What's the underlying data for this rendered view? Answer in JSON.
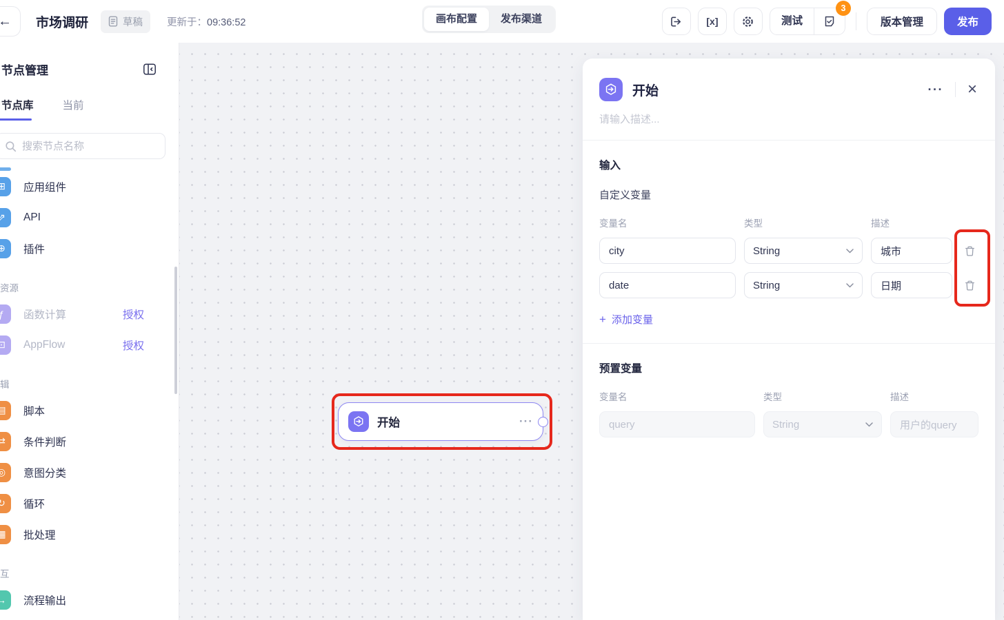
{
  "colors": {
    "accent": "#5a5fe8",
    "node_icon_purple": "#7b74f2",
    "annotation_red": "#e6281c",
    "badge_orange": "#ff9213",
    "sidebar_icon_blue": "#57a1e8",
    "sidebar_icon_lavender": "#b4aaf2",
    "sidebar_icon_orange": "#ef8f44",
    "sidebar_icon_teal": "#52c7ae"
  },
  "header": {
    "title": "市场调研",
    "draft_badge": "草稿",
    "updated_label": "更新于：",
    "updated_time": "09:36:52",
    "tabs": [
      {
        "label": "画布配置",
        "active": true
      },
      {
        "label": "发布渠道",
        "active": false
      }
    ],
    "variables_icon_text": "[x]",
    "test_label": "测试",
    "test_badge": "3",
    "version_label": "版本管理",
    "publish_label": "发布"
  },
  "sidebar": {
    "title": "节点管理",
    "tabs": [
      {
        "label": "节点库",
        "active": true
      },
      {
        "label": "当前",
        "active": false
      }
    ],
    "search_placeholder": "搜索节点名称",
    "groups": [
      {
        "label": "",
        "items": [
          {
            "label": "应用组件",
            "icon": "app-components-icon",
            "glyph": "⊞",
            "color": "blue"
          },
          {
            "label": "API",
            "icon": "api-icon",
            "glyph": "⇗",
            "color": "blue"
          },
          {
            "label": "插件",
            "icon": "plugin-icon",
            "glyph": "⊕",
            "color": "blue"
          }
        ]
      },
      {
        "label": "资源",
        "items": [
          {
            "label": "函数计算",
            "icon": "function-compute-icon",
            "glyph": "ƒ",
            "color": "lavender",
            "disabled": true,
            "action": "授权"
          },
          {
            "label": "AppFlow",
            "icon": "appflow-icon",
            "glyph": "⊡",
            "color": "lavender",
            "disabled": true,
            "action": "授权"
          }
        ]
      },
      {
        "label": "辑",
        "items": [
          {
            "label": "脚本",
            "icon": "script-icon",
            "glyph": "▤",
            "color": "orange"
          },
          {
            "label": "条件判断",
            "icon": "condition-icon",
            "glyph": "⇄",
            "color": "orange"
          },
          {
            "label": "意图分类",
            "icon": "intent-icon",
            "glyph": "◎",
            "color": "orange"
          },
          {
            "label": "循环",
            "icon": "loop-icon",
            "glyph": "↻",
            "color": "orange"
          },
          {
            "label": "批处理",
            "icon": "batch-icon",
            "glyph": "▦",
            "color": "orange"
          }
        ]
      },
      {
        "label": "互",
        "items": [
          {
            "label": "流程输出",
            "icon": "flow-output-icon",
            "glyph": "→",
            "color": "teal"
          }
        ]
      }
    ]
  },
  "canvas": {
    "node": {
      "title": "开始",
      "menu": "···"
    }
  },
  "panel": {
    "title": "开始",
    "more": "···",
    "close": "×",
    "description_placeholder": "请输入描述...",
    "input_section_label": "输入",
    "custom_vars_label": "自定义变量",
    "columns": [
      "变量名",
      "类型",
      "描述"
    ],
    "custom_vars": [
      {
        "name": "city",
        "type": "String",
        "desc": "城市"
      },
      {
        "name": "date",
        "type": "String",
        "desc": "日期"
      }
    ],
    "add_var_label": "添加变量",
    "preset_vars_label": "预置变量",
    "preset_vars": [
      {
        "name": "query",
        "type": "String",
        "desc": "用户的query",
        "disabled": true
      }
    ]
  }
}
